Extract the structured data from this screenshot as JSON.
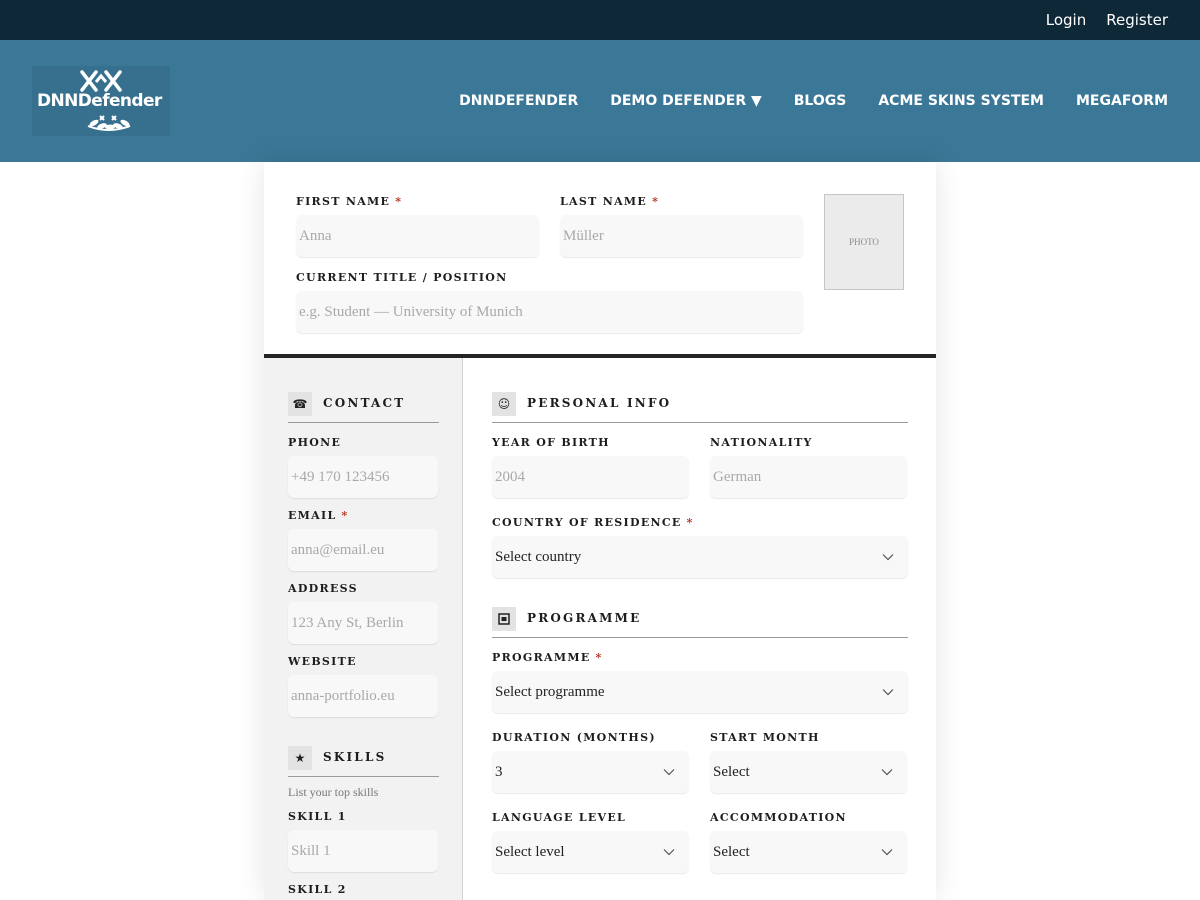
{
  "topbar": {
    "login": "Login",
    "register": "Register"
  },
  "brand": {
    "logo_text": "DNNDefender"
  },
  "nav": {
    "items": [
      "DNNDEFENDER",
      "DEMO DEFENDER ▼",
      "BLOGS",
      "ACME SKINS SYSTEM",
      "MEGAFORM"
    ]
  },
  "header_form": {
    "first_name": {
      "label": "FIRST NAME",
      "required": "*",
      "placeholder": "Anna"
    },
    "last_name": {
      "label": "LAST NAME",
      "required": "*",
      "placeholder": "Müller"
    },
    "title": {
      "label": "CURRENT TITLE / POSITION",
      "placeholder": "e.g. Student — University of Munich"
    },
    "photo_label": "PHOTO"
  },
  "contact": {
    "title": "CONTACT",
    "icon": "phone-icon",
    "phone": {
      "label": "PHONE",
      "placeholder": "+49 170 123456"
    },
    "email": {
      "label": "EMAIL",
      "required": "*",
      "placeholder": "anna@email.eu"
    },
    "address": {
      "label": "ADDRESS",
      "placeholder": "123 Any St, Berlin"
    },
    "website": {
      "label": "WEBSITE",
      "placeholder": "anna-portfolio.eu"
    }
  },
  "skills": {
    "title": "SKILLS",
    "icon": "star-icon",
    "hint": "List your top skills",
    "skill1": {
      "label": "SKILL 1",
      "placeholder": "Skill 1"
    },
    "skill2": {
      "label": "SKILL 2"
    }
  },
  "personal": {
    "title": "PERSONAL INFO",
    "icon": "smiley-icon",
    "year_of_birth": {
      "label": "YEAR OF BIRTH",
      "placeholder": "2004"
    },
    "nationality": {
      "label": "NATIONALITY",
      "placeholder": "German"
    },
    "country": {
      "label": "COUNTRY OF RESIDENCE",
      "required": "*",
      "value": "Select country"
    }
  },
  "programme": {
    "title": "PROGRAMME",
    "icon": "document-icon",
    "programme": {
      "label": "PROGRAMME",
      "required": "*",
      "value": "Select programme"
    },
    "duration": {
      "label": "DURATION (MONTHS)",
      "value": "3"
    },
    "start_month": {
      "label": "START MONTH",
      "value": "Select"
    },
    "language": {
      "label": "LANGUAGE LEVEL",
      "value": "Select level"
    },
    "accommodation": {
      "label": "ACCOMMODATION",
      "value": "Select"
    }
  },
  "colors": {
    "topbar": "#0f2838",
    "header": "#3b7797",
    "required": "#b0331f",
    "divider": "#242424"
  }
}
